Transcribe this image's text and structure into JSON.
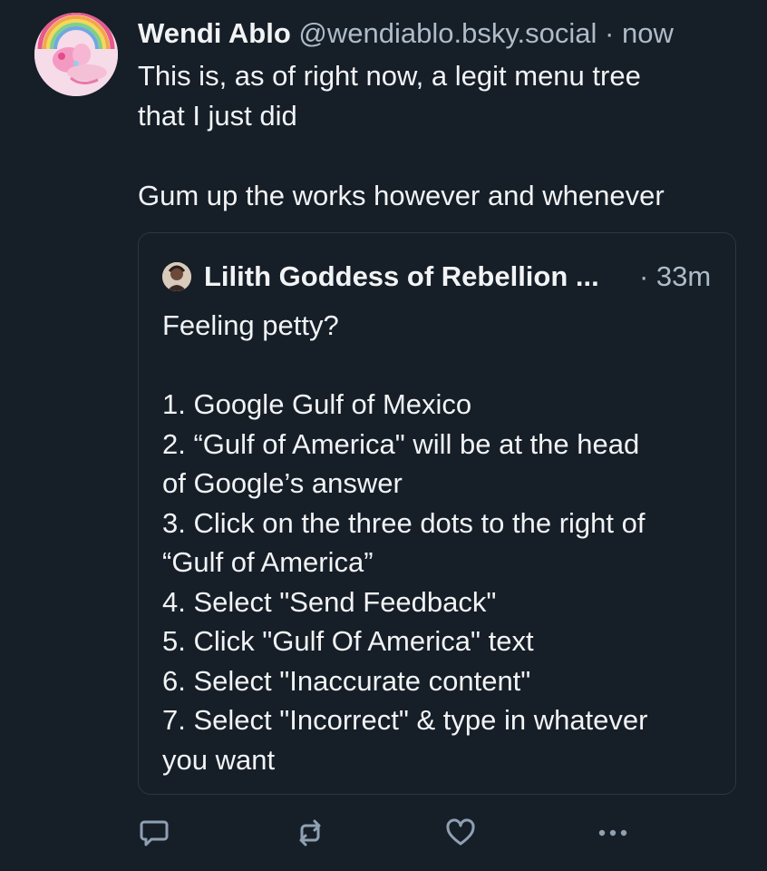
{
  "post": {
    "author": {
      "display_name": "Wendi Ablo",
      "handle": "@wendiablo.bsky.social",
      "separator": "·",
      "timestamp": "now"
    },
    "text_lines": [
      "This is, as of right now, a legit menu tree",
      "that I just did",
      "",
      "Gum up the works however and whenever"
    ],
    "quote": {
      "author_name": "Lilith Goddess of Rebellion ...",
      "timestamp": "· 33m",
      "lines": [
        "Feeling petty?",
        "",
        "1. Google Gulf of Mexico",
        "2. “Gulf of America\" will be at the head",
        "of Google’s answer",
        "3. Click on the three dots to the right of",
        "“Gulf of America”",
        "4. Select \"Send Feedback\"",
        "5. Click \"Gulf Of America\" text",
        "6. Select \"Inaccurate content\"",
        "7. Select \"Incorrect\" & type in whatever",
        "you want"
      ]
    },
    "actions": [
      {
        "name": "reply-button",
        "icon": "speech-bubble-icon"
      },
      {
        "name": "repost-button",
        "icon": "repost-arrows-icon"
      },
      {
        "name": "like-button",
        "icon": "heart-icon"
      },
      {
        "name": "more-options-button",
        "icon": "ellipsis-icon"
      }
    ]
  },
  "colors": {
    "background": "#161e27",
    "text_primary": "#f1f3f5",
    "text_secondary": "#aebbc9",
    "border": "#2b3744",
    "icon": "#8fa0b3"
  }
}
